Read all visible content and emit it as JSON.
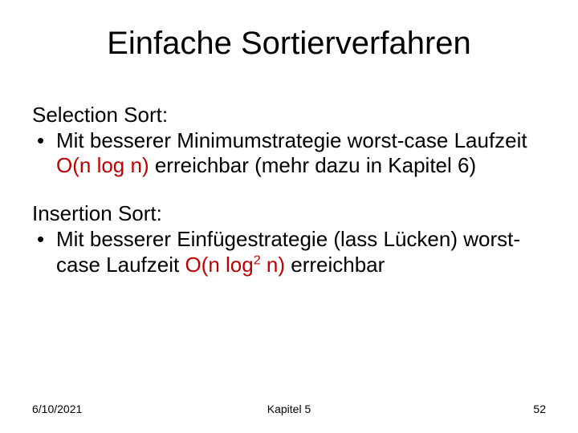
{
  "title": "Einfache Sortierverfahren",
  "selection": {
    "heading": "Selection Sort:",
    "bullet_dot": "•",
    "bullet_pre": "Mit besserer Minimumstrategie worst-case Laufzeit ",
    "bullet_hl": "O(n log n)",
    "bullet_post": " erreichbar (mehr dazu in Kapitel 6)"
  },
  "insertion": {
    "heading": "Insertion Sort:",
    "bullet_dot": "•",
    "bullet_pre": "Mit besserer Einfügestrategie (lass Lücken) worst-case Laufzeit ",
    "bullet_hl_pre": "O(n log",
    "bullet_hl_exp": "2",
    "bullet_hl_post": " n)",
    "bullet_post": " erreichbar"
  },
  "footer": {
    "date": "6/10/2021",
    "chapter": "Kapitel 5",
    "page": "52"
  }
}
